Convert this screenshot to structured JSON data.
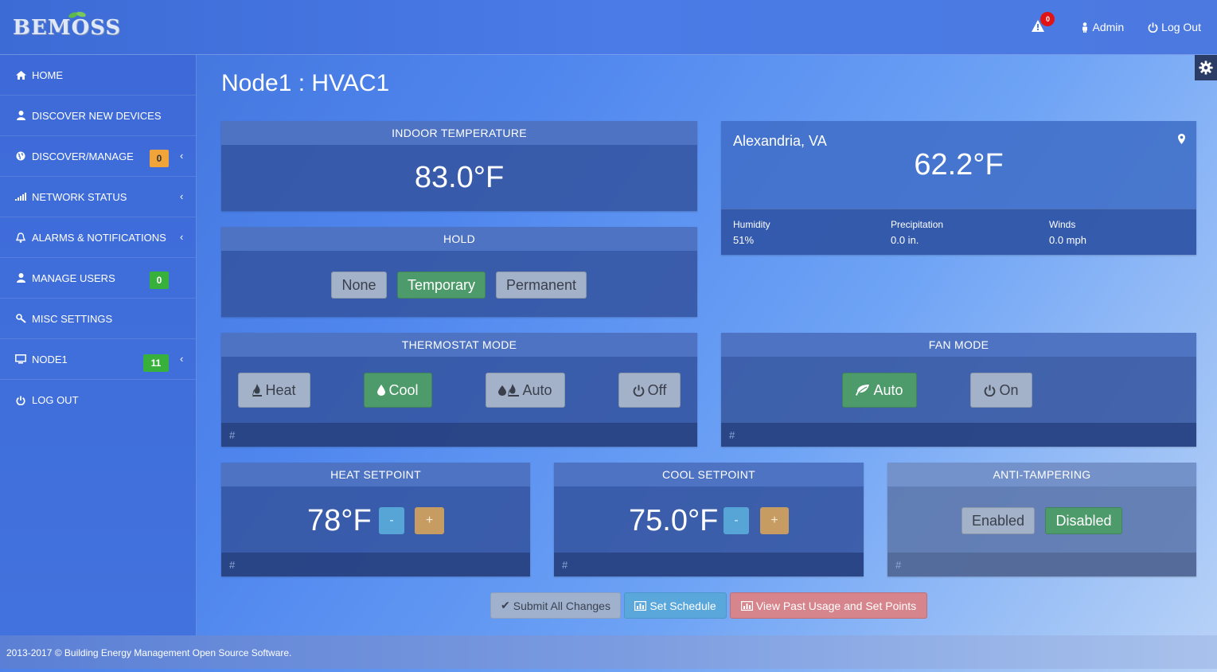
{
  "header": {
    "logo_text": "BEMOSS",
    "alert_count": "0",
    "admin_label": "Admin",
    "logout_label": "Log Out"
  },
  "sidebar": {
    "items": [
      {
        "label": "HOME",
        "icon": "home-icon"
      },
      {
        "label": "DISCOVER NEW DEVICES",
        "icon": "user-icon"
      },
      {
        "label": "DISCOVER/MANAGE",
        "icon": "globe-icon",
        "badge": "0",
        "badge_color": "#f0a43a"
      },
      {
        "label": "NETWORK STATUS",
        "icon": "signal-icon"
      },
      {
        "label": "ALARMS & NOTIFICATIONS",
        "icon": "bell-icon"
      },
      {
        "label": "MANAGE USERS",
        "icon": "user-icon",
        "badge": "0",
        "badge_color": "#37b13b"
      },
      {
        "label": "MISC SETTINGS",
        "icon": "wrench-icon"
      },
      {
        "label": "NODE1",
        "icon": "monitor-icon",
        "badge": "11",
        "badge_color": "#37b13b"
      },
      {
        "label": "LOG OUT",
        "icon": "power-icon"
      }
    ]
  },
  "main": {
    "title": "Node1 : HVAC1",
    "indoor": {
      "heading": "INDOOR TEMPERATURE",
      "value": "83.0°F"
    },
    "hold": {
      "heading": "HOLD",
      "none": "None",
      "temporary": "Temporary",
      "permanent": "Permanent",
      "selected": "Temporary"
    },
    "thermostat": {
      "heading": "THERMOSTAT MODE",
      "heat": "Heat",
      "cool": "Cool",
      "auto": "Auto",
      "off": "Off",
      "selected": "Cool",
      "footer": "#"
    },
    "fan": {
      "heading": "FAN MODE",
      "auto": "Auto",
      "on": "On",
      "selected": "Auto",
      "footer": "#"
    },
    "heat_setpoint": {
      "heading": "HEAT SETPOINT",
      "value": "78°F",
      "minus": "-",
      "plus": "+",
      "footer": "#"
    },
    "cool_setpoint": {
      "heading": "COOL SETPOINT",
      "value": "75.0°F",
      "minus": "-",
      "plus": "+",
      "footer": "#"
    },
    "anti_tampering": {
      "heading": "ANTI-TAMPERING",
      "enabled": "Enabled",
      "disabled": "Disabled",
      "selected": "Disabled",
      "footer": "#"
    }
  },
  "weather": {
    "city": "Alexandria, VA",
    "temperature": "62.2°F",
    "humidity_label": "Humidity",
    "humidity": "51%",
    "precip_label": "Precipitation",
    "precip": "0.0 in.",
    "winds_label": "Winds",
    "winds": "0.0 mph"
  },
  "actions": {
    "submit": "Submit All Changes",
    "schedule": "Set Schedule",
    "history": "View Past Usage and Set Points"
  },
  "footer": {
    "text": "2013-2017 © Building Energy Management Open Source Software."
  },
  "colors": {
    "accent_green": "#4d9a6a",
    "badge_orange": "#f0a43a",
    "badge_green": "#37b13b",
    "alert_red": "#e01414"
  }
}
